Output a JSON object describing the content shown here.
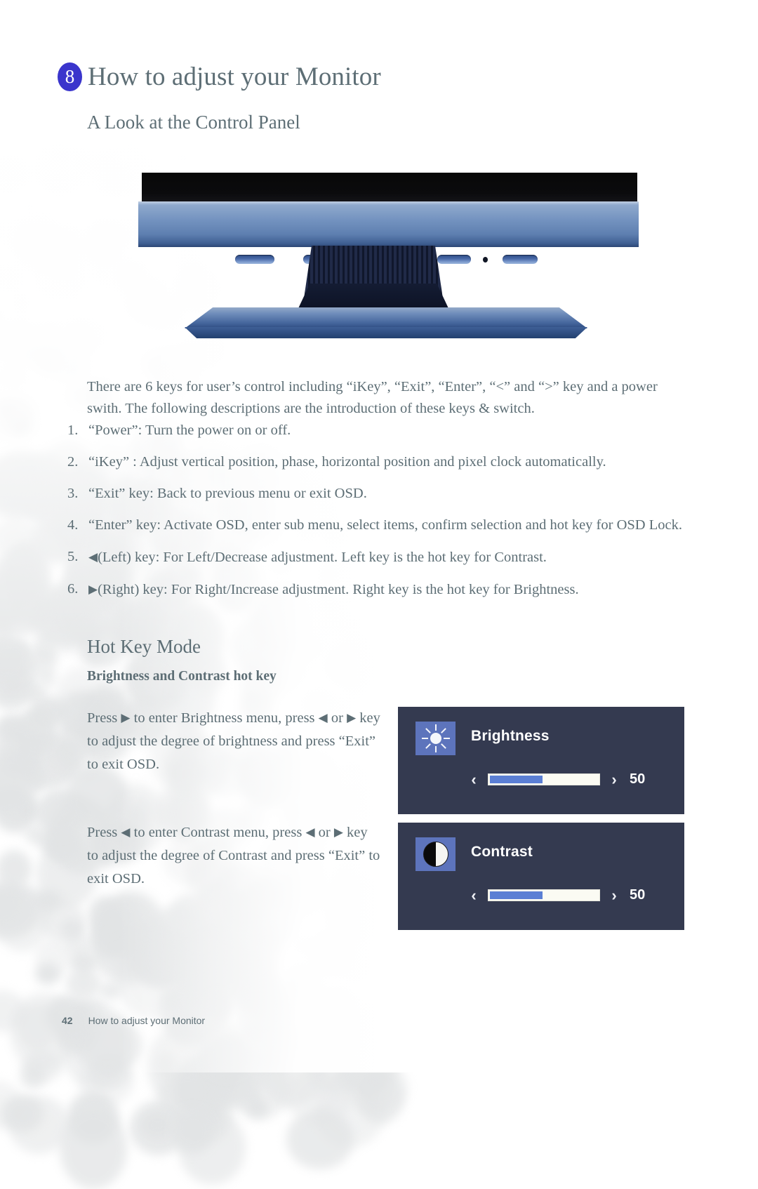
{
  "chapter": {
    "number": "8",
    "title": "How to adjust your Monitor",
    "section_title": "A Look at the Control Panel"
  },
  "intro": {
    "paragraph": "There are 6 keys for user’s control including “iKey”, “Exit”, “Enter”, “<” and “>” key and a power swith. The following descriptions are the introduction of these keys & switch."
  },
  "key_list": [
    {
      "marker": "1.",
      "text": "“Power”: Turn the power on or off."
    },
    {
      "marker": "2.",
      "text": "“iKey” : Adjust vertical position, phase, horizontal position and pixel clock automatically."
    },
    {
      "marker": "3.",
      "text": "“Exit” key: Back to previous menu or exit OSD."
    },
    {
      "marker": "4.",
      "text": "“Enter” key: Activate OSD, enter sub menu, select items, confirm selection and hot key for OSD Lock."
    },
    {
      "marker": "5.",
      "icon": "◀",
      "text": "(Left) key: For Left/Decrease adjustment. Left key is the hot key for Contrast."
    },
    {
      "marker": "6.",
      "icon": "▶",
      "text": "(Right) key: For Right/Increase adjustment. Right key is the hot key for Brightness."
    }
  ],
  "hotkey": {
    "title": "Hot Key Mode",
    "subtitle": "Brightness and Contrast hot key",
    "brightness_paragraph": {
      "part1": "Press ",
      "icon1": "▶",
      "part2": " to enter Brightness menu, press ",
      "icon2": "◀",
      "part3": " or ",
      "icon3": "▶",
      "part4": " key to adjust the degree of brightness and press “Exit” to exit OSD."
    },
    "contrast_paragraph": {
      "part1": "Press ",
      "icon1": "◀",
      "part2": " to enter Contrast menu, press ",
      "icon2": "◀",
      "part3": " or ",
      "icon3": "▶",
      "part4": " key to adjust the degree of Contrast and press “Exit” to exit OSD."
    }
  },
  "osd": {
    "brightness": {
      "icon": "sun-icon",
      "label": "Brightness",
      "value": "50",
      "fill_percent": 50,
      "left_arrow": "‹",
      "right_arrow": "›"
    },
    "contrast": {
      "icon": "half-circle-icon",
      "label": "Contrast",
      "value": "50",
      "fill_percent": 50,
      "left_arrow": "‹",
      "right_arrow": "›"
    }
  },
  "footer": {
    "page_number": "42",
    "running_title": "How to adjust your Monitor"
  },
  "colors": {
    "text": "#5d6e75",
    "badge": "#3a35cc",
    "osd_background": "#343a50",
    "osd_icon_tile": "#5d74bc",
    "slider_fill": "#5b7fd4",
    "slider_track": "#fbfbf3"
  },
  "monitor_photo": {
    "buttons": 6,
    "led_indicator": true
  }
}
